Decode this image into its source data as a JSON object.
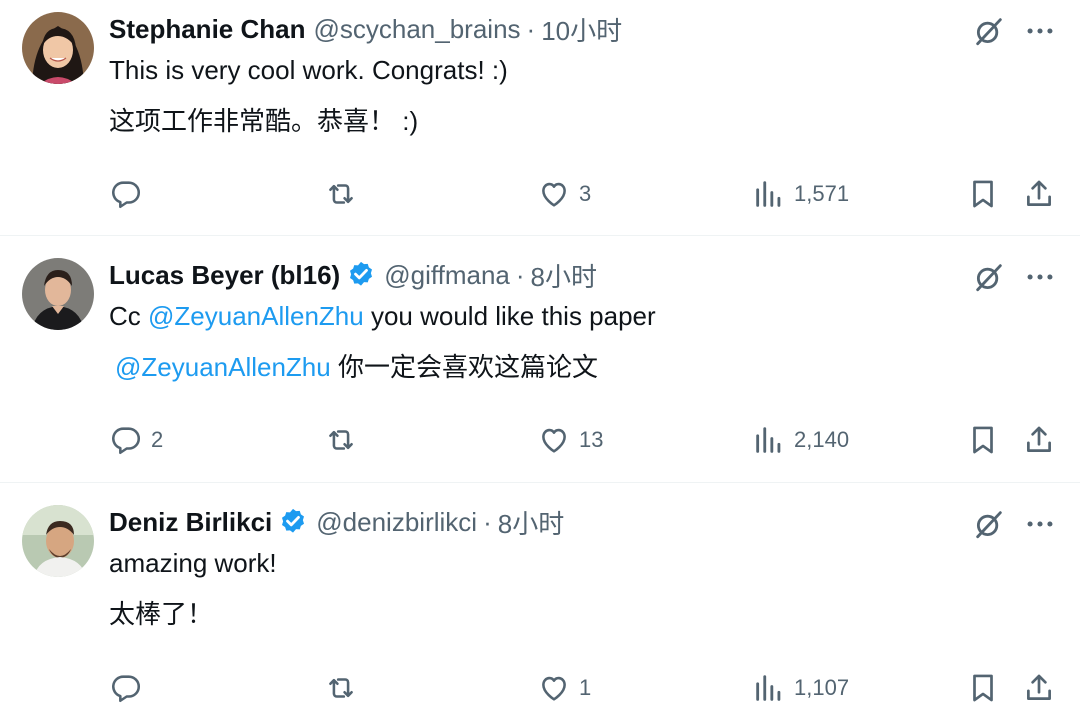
{
  "tweets": [
    {
      "name": "Stephanie Chan",
      "handle": "@scychan_brains",
      "separator": "·",
      "time": "10小时",
      "verified": false,
      "line1": "This is very cool work. Congrats! :)",
      "line2": "这项工作非常酷。恭喜！ :)",
      "replies": "",
      "likes": "3",
      "views": "1,571"
    },
    {
      "name": "Lucas Beyer (bl16)",
      "handle": "@giffmana",
      "separator": "·",
      "time": "8小时",
      "verified": true,
      "line1_prefix": "Cc ",
      "line1_mention": "@ZeyuanAllenZhu",
      "line1_suffix": " you would like this paper",
      "line2_mention": "@ZeyuanAllenZhu",
      "line2_suffix": " 你一定会喜欢这篇论文",
      "replies": "2",
      "likes": "13",
      "views": "2,140"
    },
    {
      "name": "Deniz Birlikci",
      "handle": "@denizbirlikci",
      "separator": "·",
      "time": "8小时",
      "verified": true,
      "line1": "amazing work!",
      "line2": "太棒了！",
      "replies": "",
      "likes": "1",
      "views": "1,107"
    }
  ],
  "icons": {
    "reply": "reply-icon",
    "retweet": "retweet-icon",
    "like": "like-icon",
    "views": "views-icon",
    "bookmark": "bookmark-icon",
    "share": "share-icon",
    "grok": "grok-icon",
    "more": "more-icon",
    "verified": "verified-badge-icon"
  },
  "colors": {
    "text": "#0f1419",
    "secondary": "#536471",
    "link": "#1d9bf0",
    "divider": "#eff3f4"
  }
}
